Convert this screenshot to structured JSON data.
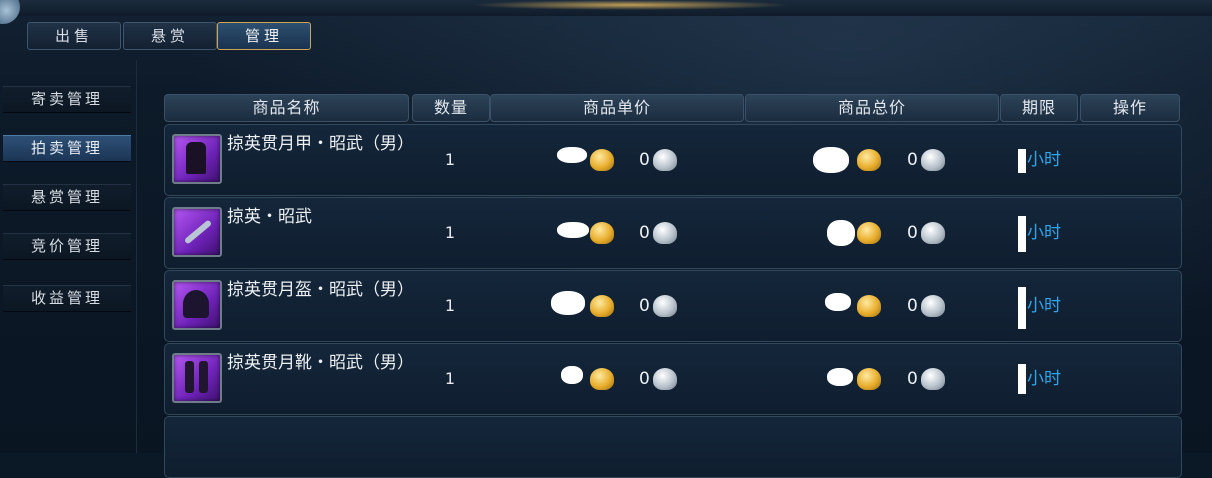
{
  "tabs": [
    {
      "label": "出售"
    },
    {
      "label": "悬赏"
    },
    {
      "label": "管理"
    }
  ],
  "sidebar": {
    "items": [
      {
        "label": "寄卖管理"
      },
      {
        "label": "拍卖管理"
      },
      {
        "label": "悬赏管理"
      },
      {
        "label": "竞价管理"
      },
      {
        "label": "收益管理"
      }
    ],
    "active_index": 1
  },
  "table": {
    "headers": [
      "商品名称",
      "数量",
      "商品单价",
      "商品总价",
      "期限",
      "操作"
    ],
    "rows": [
      {
        "name": "掠英贯月甲・昭武（男）",
        "icon": "armor-icon",
        "quantity": "1",
        "unit_silver": "0",
        "total_silver": "0",
        "time_suffix": "小时"
      },
      {
        "name": "掠英・昭武",
        "icon": "blade-icon",
        "quantity": "1",
        "unit_silver": "0",
        "total_silver": "0",
        "time_suffix": "小时"
      },
      {
        "name": "掠英贯月盔・昭武（男）",
        "icon": "helmet-icon",
        "quantity": "1",
        "unit_silver": "0",
        "total_silver": "0",
        "time_suffix": "小时"
      },
      {
        "name": "掠英贯月靴・昭武（男）",
        "icon": "boots-icon",
        "quantity": "1",
        "unit_silver": "0",
        "total_silver": "0",
        "time_suffix": "小时"
      }
    ]
  },
  "colors": {
    "time_text": "#2fa5ee",
    "active_tab_border": "#cfa456",
    "item_icon_bg": "#8a35d4"
  },
  "currency_icons": [
    "gold-ingot-icon",
    "silver-ingot-icon"
  ]
}
